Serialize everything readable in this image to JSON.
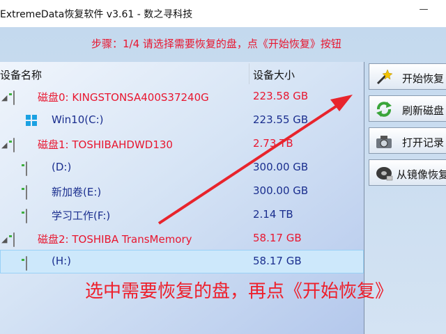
{
  "window": {
    "title": "ExtremeData恢复软件 v3.61  -  数之寻科技",
    "minimize_glyph": "—"
  },
  "instruction": "步骤：1/4 请选择需要恢复的盘，点《开始恢复》按钮",
  "table": {
    "columns": [
      "设备名称",
      "设备大小"
    ],
    "rows": [
      {
        "name": "磁盘0: KINGSTONSA400S37240G",
        "size": "223.58 GB",
        "kind": "disk",
        "level": 0
      },
      {
        "name": "Win10(C:)",
        "size": "223.55 GB",
        "kind": "windows-partition",
        "level": 1
      },
      {
        "name": "磁盘1: TOSHIBAHDWD130",
        "size": "2.73 TB",
        "kind": "disk",
        "level": 0
      },
      {
        "name": "(D:)",
        "size": "300.00 GB",
        "kind": "partition",
        "level": 1
      },
      {
        "name": "新加卷(E:)",
        "size": "300.00 GB",
        "kind": "partition",
        "level": 1
      },
      {
        "name": "学习工作(F:)",
        "size": "2.14 TB",
        "kind": "partition",
        "level": 1
      },
      {
        "name": "磁盘2: TOSHIBA  TransMemory",
        "size": "58.17 GB",
        "kind": "disk",
        "level": 0
      },
      {
        "name": "(H:)",
        "size": "58.17 GB",
        "kind": "partition",
        "level": 1,
        "selected": true
      }
    ]
  },
  "buttons": [
    {
      "label": "开始恢复",
      "icon": "magic-wand-icon"
    },
    {
      "label": "刷新磁盘",
      "icon": "refresh-icon"
    },
    {
      "label": "打开记录",
      "icon": "camera-icon"
    },
    {
      "label": "从镜像恢复",
      "icon": "disk-image-icon"
    }
  ],
  "annotation": {
    "caption": "选中需要恢复的盘，再点《开始恢复》",
    "arrow_color": "#e8242c"
  },
  "colors": {
    "disk_text": "#e8162f",
    "partition_text": "#1a2e8e",
    "selection": "#cde8fb"
  }
}
